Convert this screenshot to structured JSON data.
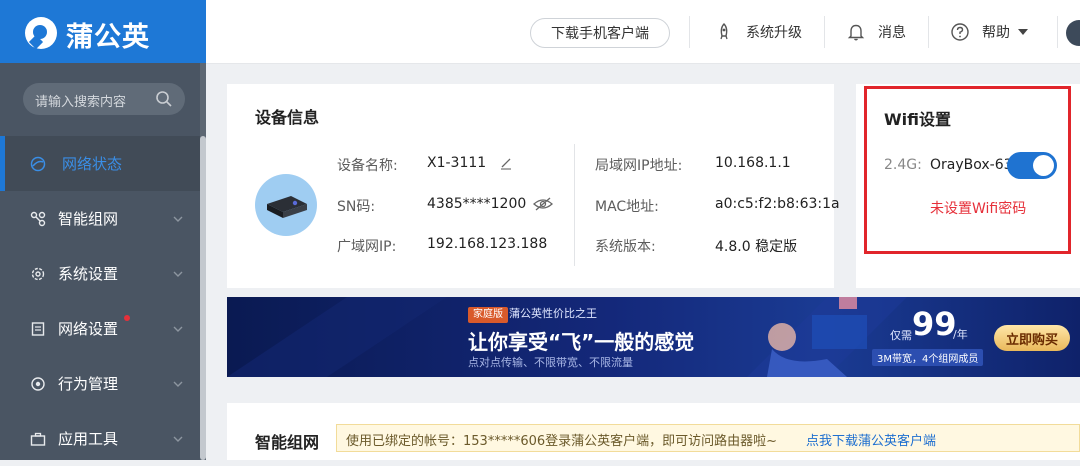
{
  "sidebar": {
    "logo": "蒲公英",
    "search_placeholder": "请输入搜索内容",
    "items": [
      {
        "label": "网络状态",
        "icon": "globe-icon",
        "active": true
      },
      {
        "label": "智能组网",
        "icon": "network-icon"
      },
      {
        "label": "系统设置",
        "icon": "gear-icon"
      },
      {
        "label": "网络设置",
        "icon": "doc-icon",
        "badge": "red-dot"
      },
      {
        "label": "行为管理",
        "icon": "behavior-icon"
      },
      {
        "label": "应用工具",
        "icon": "toolbox-icon"
      }
    ]
  },
  "header": {
    "download_label": "下载手机客户端",
    "upgrade_label": "系统升级",
    "messages_label": "消息",
    "help_label": "帮助"
  },
  "device": {
    "title": "设备信息",
    "name_label": "设备名称:",
    "name_value": "X1-3111",
    "sn_label": "SN码:",
    "sn_value": "4385****1200",
    "wan_label": "广域网IP:",
    "wan_value": "192.168.123.188",
    "lan_label": "局域网IP地址:",
    "lan_value": "10.168.1.1",
    "mac_label": "MAC地址:",
    "mac_value": "a0:c5:f2:b8:63:1a",
    "ver_label": "系统版本:",
    "ver_value": "4.8.0 稳定版"
  },
  "wifi": {
    "title": "Wifi设置",
    "band": "2.4G:",
    "ssid": "OrayBox-63",
    "enabled": true,
    "warning": "未设置Wifi密码"
  },
  "banner": {
    "tag": "家庭版",
    "subtitle": "蒲公英性价比之王",
    "headline": "让你享受“飞”一般的感觉",
    "features": "点对点传输、不限带宽、不限流量",
    "price_prefix": "仅需",
    "price": "99",
    "price_unit": "/年",
    "plan": "3M带宽，4个组网成员",
    "buy_label": "立即购买"
  },
  "mesh": {
    "title": "智能组网",
    "notice_text": "使用已绑定的帐号：153*****606登录蒲公英客户端，即可访问路由器啦~",
    "notice_link": "点我下载蒲公英客户端"
  },
  "colors": {
    "brand": "#1e78d6",
    "sidebar": "#4a5563",
    "warning": "#e6303a",
    "highlight_border": "#e1252b"
  }
}
